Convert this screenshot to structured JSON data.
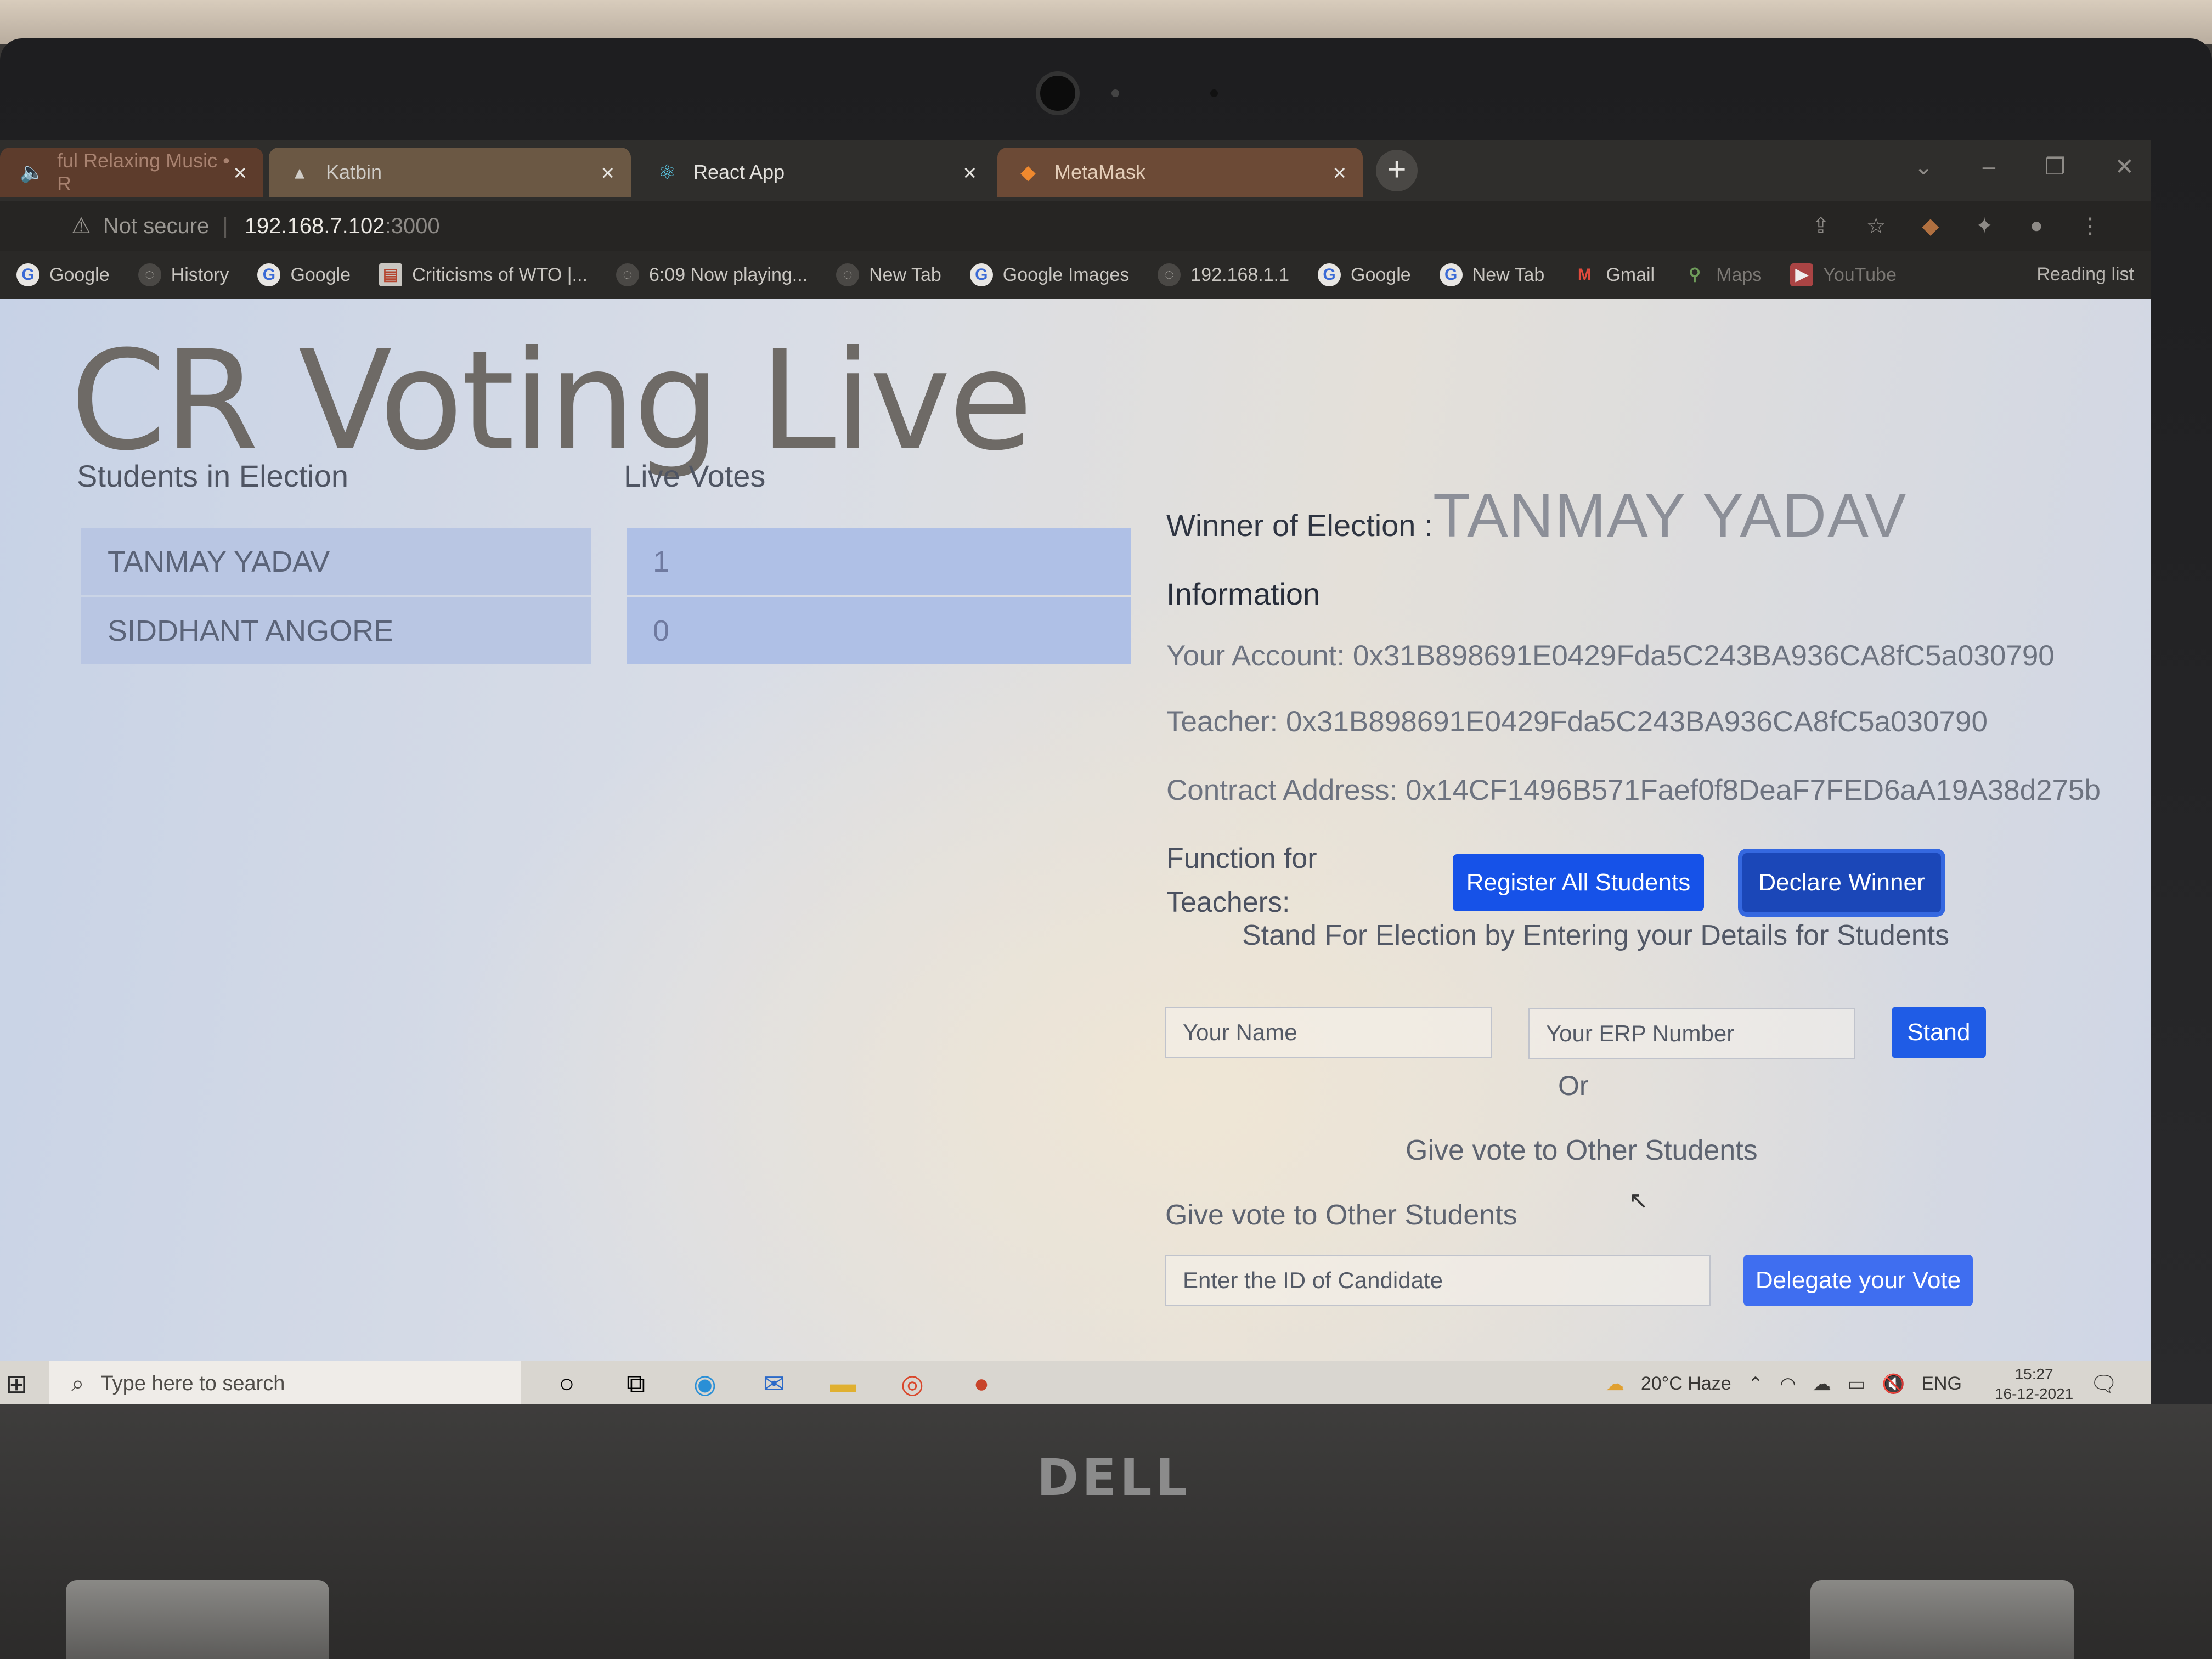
{
  "laptop": {
    "brand": "DELL"
  },
  "browser": {
    "tabs": [
      {
        "label": "ful Relaxing Music • R",
        "favicon": "speaker-icon"
      },
      {
        "label": "Katbin",
        "favicon": "katbin-icon"
      },
      {
        "label": "React App",
        "favicon": "react-icon",
        "active": true
      },
      {
        "label": "MetaMask",
        "favicon": "metamask-fox-icon"
      }
    ],
    "new_tab": "+",
    "address": {
      "security": "Not secure",
      "host": "192.168.7.102",
      "port": ":3000"
    },
    "bookmarks": [
      {
        "label": "Google",
        "icon": "google-icon"
      },
      {
        "label": "History",
        "icon": "globe-icon"
      },
      {
        "label": "Google",
        "icon": "google-icon"
      },
      {
        "label": "Criticisms of WTO |...",
        "icon": "doc-icon"
      },
      {
        "label": "6:09 Now playing...",
        "icon": "globe-icon"
      },
      {
        "label": "New Tab",
        "icon": "globe-icon"
      },
      {
        "label": "Google Images",
        "icon": "google-icon"
      },
      {
        "label": "192.168.1.1",
        "icon": "globe-icon"
      },
      {
        "label": "Google",
        "icon": "google-icon"
      },
      {
        "label": "New Tab",
        "icon": "google-icon"
      },
      {
        "label": "Gmail",
        "icon": "gmail-icon"
      },
      {
        "label": "Maps",
        "icon": "maps-icon"
      },
      {
        "label": "YouTube",
        "icon": "youtube-icon"
      }
    ],
    "reading_list": "Reading list"
  },
  "page": {
    "title": "CR Voting Live",
    "students_header": "Students in Election",
    "votes_header": "Live Votes",
    "candidates": [
      {
        "name": "TANMAY YADAV",
        "votes": "1"
      },
      {
        "name": "SIDDHANT ANGORE",
        "votes": "0"
      }
    ],
    "winner_label": "Winner of Election :",
    "winner_name": "TANMAY YADAV",
    "info_header": "Information",
    "account": "Your Account: 0x31B898691E0429Fda5C243BA936CA8fC5a030790",
    "teacher": "Teacher: 0x31B898691E0429Fda5C243BA936CA8fC5a030790",
    "contract": "Contract Address: 0x14CF1496B571Faef0f8DeaF7FED6aA19A38d275b",
    "function_label": "Function for Teachers:",
    "register_button": "Register All Students",
    "declare_button": "Declare Winner",
    "stand_caption": "Stand For Election by Entering your Details for Students",
    "name_placeholder": "Your Name",
    "erp_placeholder": "Your ERP Number",
    "stand_button": "Stand",
    "or_text": "Or",
    "give_vote_center": "Give vote to Other Students",
    "give_vote_left": "Give vote to Other Students",
    "delegate_placeholder": "Enter the ID of Candidate",
    "delegate_button": "Delegate your Vote"
  },
  "taskbar": {
    "search_placeholder": "Type here to search",
    "weather": "20°C Haze",
    "language": "ENG",
    "time": "15:27",
    "date": "16-12-2021"
  }
}
